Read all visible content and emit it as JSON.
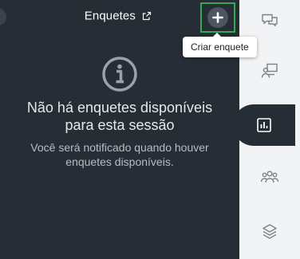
{
  "panel": {
    "title": "Enquetes",
    "title_icon": "external-link-icon",
    "add_button_icon": "plus-icon",
    "add_tooltip": "Criar enquete"
  },
  "empty_state": {
    "icon": "info-icon",
    "title": "Não há enquetes disponíveis para esta sessão",
    "description": "Você será notificado quando houver enquetes disponíveis."
  },
  "rail": {
    "items": [
      {
        "icon": "chat-icon",
        "active": false
      },
      {
        "icon": "presenter-icon",
        "active": false
      },
      {
        "icon": "poll-chart-icon",
        "active": true
      },
      {
        "icon": "people-icon",
        "active": false
      },
      {
        "icon": "layers-icon",
        "active": false
      }
    ]
  },
  "colors": {
    "panel_bg": "#262d35",
    "rail_bg": "#f2f3f5",
    "highlight_border": "#34a853",
    "text_primary": "#e6e9ec",
    "text_secondary": "#b7bdc4"
  }
}
